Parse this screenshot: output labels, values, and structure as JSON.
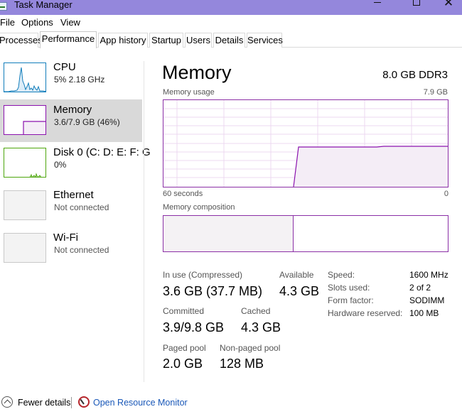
{
  "window": {
    "title": "Task Manager",
    "minimize": "–",
    "maximize": "□",
    "close": "✕"
  },
  "menu": [
    "File",
    "Options",
    "View"
  ],
  "tabs": [
    "Processes",
    "Performance",
    "App history",
    "Startup",
    "Users",
    "Details",
    "Services"
  ],
  "active_tab": "Performance",
  "sidebar": {
    "items": [
      {
        "name": "CPU",
        "sub": "5% 2.18 GHz",
        "color": "#117dbb"
      },
      {
        "name": "Memory",
        "sub": "3.6/7.9 GB (46%)",
        "color": "#8b12ae",
        "selected": true
      },
      {
        "name": "Disk 0 (C: D: E: F: G",
        "sub": "0%",
        "color": "#4da60c"
      },
      {
        "name": "Ethernet",
        "sub": "Not connected",
        "color": "#a0a0a0"
      },
      {
        "name": "Wi-Fi",
        "sub": "Not connected",
        "color": "#a0a0a0"
      }
    ]
  },
  "main": {
    "title": "Memory",
    "spec": "8.0 GB DDR3",
    "usage_label": "Memory usage",
    "usage_max": "7.9 GB",
    "time_left": "60 seconds",
    "time_right": "0",
    "composition_label": "Memory composition",
    "usage_percent": 46,
    "accent": "#8b12ae"
  },
  "stats": {
    "in_use_label": "In use (Compressed)",
    "in_use_value": "3.6 GB (37.7 MB)",
    "available_label": "Available",
    "available_value": "4.3 GB",
    "committed_label": "Committed",
    "committed_value": "3.9/9.8 GB",
    "cached_label": "Cached",
    "cached_value": "4.3 GB",
    "paged_label": "Paged pool",
    "paged_value": "2.0 GB",
    "nonpaged_label": "Non-paged pool",
    "nonpaged_value": "128 MB"
  },
  "specs": [
    {
      "label": "Speed:",
      "value": "1600 MHz"
    },
    {
      "label": "Slots used:",
      "value": "2 of 2"
    },
    {
      "label": "Form factor:",
      "value": "SODIMM"
    },
    {
      "label": "Hardware reserved:",
      "value": "100 MB"
    }
  ],
  "footer": {
    "fewer_details": "Fewer details",
    "resource_monitor": "Open Resource Monitor"
  }
}
